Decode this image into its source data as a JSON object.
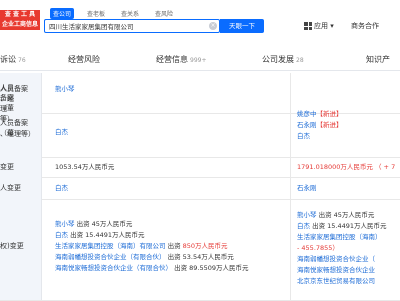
{
  "logo": {
    "line1": "查 查 工 具",
    "line2": "企业工商信息"
  },
  "search_tabs": [
    {
      "label": "查公司",
      "active": true
    },
    {
      "label": "查老板",
      "active": false
    },
    {
      "label": "查关系",
      "active": false
    },
    {
      "label": "查风险",
      "active": false
    }
  ],
  "search": {
    "value": "四川生活家家居集团有限公司",
    "button": "天眼一下"
  },
  "header_links": {
    "apps": "应用",
    "business": "商务合作"
  },
  "nav": [
    {
      "label": "诉讼",
      "count": "76"
    },
    {
      "label": "经营风险",
      "count": ""
    },
    {
      "label": "经营信息",
      "count": "999+"
    },
    {
      "label": "公司发展",
      "count": "28"
    },
    {
      "label": "知识产",
      "count": ""
    }
  ],
  "rows": [
    {
      "label": [
        "人员备案"
      ],
      "left": [
        {
          "t": "熊小琴",
          "c": "blue"
        }
      ],
      "right": []
    },
    {
      "label": [
        "人员备案（董",
        "、经理等）"
      ],
      "left": [],
      "right": []
    },
    {
      "label": [
        "人员备案（董",
        "、经理等）"
      ],
      "left": [
        {
          "t": "白杰",
          "c": "blue"
        }
      ],
      "right": [
        {
          "t": "姚彦中",
          "c": "blue",
          "tag": "【新进】"
        },
        {
          "t": "石永刚",
          "c": "blue",
          "tag": "【新进】"
        },
        {
          "t": "白杰",
          "c": "blue"
        }
      ]
    },
    {
      "label": [
        "变更"
      ],
      "left": [
        {
          "t": "1053.54万人民币元",
          "c": "dark"
        }
      ],
      "right": [
        {
          "t": "1791.018000万人民币元 （ + 7",
          "c": "red"
        }
      ]
    },
    {
      "label": [
        "人变更"
      ],
      "left": [
        {
          "t": "白杰",
          "c": "blue"
        }
      ],
      "right": [
        {
          "t": "石永刚",
          "c": "blue"
        }
      ]
    },
    {
      "label": [
        "权)变更"
      ],
      "left": [
        {
          "t": "熊小琴",
          "c": "blue",
          "rest": " 出资 45万人民币元"
        },
        {
          "t": "白杰",
          "c": "blue",
          "rest": " 出资 15.4491万人民币元"
        },
        {
          "t": "生活家家居集团控股（海南）有限公司",
          "c": "blue",
          "rest": " 出资 ",
          "red": "850万人民币元"
        },
        {
          "t": "海南弱幡想投资合伙企业（有限合伙）",
          "c": "blue",
          "rest": " 出资 53.54万人民币元"
        },
        {
          "t": "海南悦家畅想投资合伙企业（有限合伙）",
          "c": "blue",
          "rest": " 出资 89.5509万人民币元"
        }
      ],
      "right": [
        {
          "t": "熊小琴",
          "c": "blue",
          "rest": " 出资 45万人民币元"
        },
        {
          "t": "白杰",
          "c": "blue",
          "rest": " 出资 15.4491万人民币元"
        },
        {
          "t": "生活家家居集团控股（海南）",
          "c": "blue"
        },
        {
          "t": "- 455.7855）",
          "c": "red"
        },
        {
          "t": "海南弱幡想投资合伙企业（",
          "c": "blue"
        },
        {
          "t": "海南悦家畅想投资合伙企业",
          "c": "blue"
        },
        {
          "t": "北京京东世纪贸易有限公司",
          "c": "blue"
        }
      ]
    }
  ]
}
